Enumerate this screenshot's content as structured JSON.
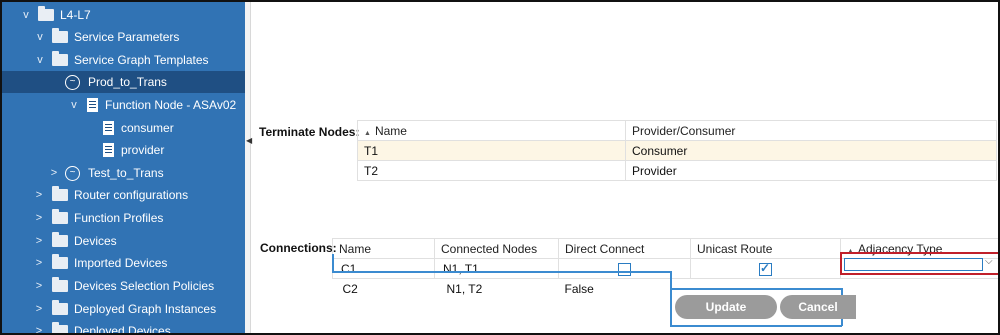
{
  "sidebar": {
    "items": [
      {
        "label": "L4-L7",
        "chevron": "v",
        "icon": "folder-icon"
      },
      {
        "label": "Service Parameters",
        "chevron": "v",
        "icon": "folder-icon"
      },
      {
        "label": "Service Graph Templates",
        "chevron": "v",
        "icon": "folder-icon"
      },
      {
        "label": "Prod_to_Trans",
        "chevron": "",
        "icon": "graph-icon"
      },
      {
        "label": "Function Node - ASAv02",
        "chevron": "v",
        "icon": "document-icon"
      },
      {
        "label": "consumer",
        "chevron": "",
        "icon": "document-icon"
      },
      {
        "label": "provider",
        "chevron": "",
        "icon": "document-icon"
      },
      {
        "label": "Test_to_Trans",
        "chevron": ">",
        "icon": "graph-icon"
      },
      {
        "label": "Router configurations",
        "chevron": ">",
        "icon": "folder-icon"
      },
      {
        "label": "Function Profiles",
        "chevron": ">",
        "icon": "folder-icon"
      },
      {
        "label": "Devices",
        "chevron": ">",
        "icon": "folder-icon"
      },
      {
        "label": "Imported Devices",
        "chevron": ">",
        "icon": "folder-icon"
      },
      {
        "label": "Devices Selection Policies",
        "chevron": ">",
        "icon": "folder-icon"
      },
      {
        "label": "Deployed Graph Instances",
        "chevron": ">",
        "icon": "folder-icon"
      },
      {
        "label": "Deployed Devices",
        "chevron": ">",
        "icon": "folder-icon"
      }
    ]
  },
  "terminate": {
    "label": "Terminate Nodes:",
    "headers": [
      "Name",
      "Provider/Consumer"
    ],
    "rows": [
      [
        "T1",
        "Consumer"
      ],
      [
        "T2",
        "Provider"
      ]
    ]
  },
  "connections": {
    "label": "Connections:",
    "headers": [
      "Name",
      "Connected Nodes",
      "Direct Connect",
      "Unicast Route",
      "Adjacency Type"
    ],
    "rows": [
      {
        "name": "C1",
        "nodes": "N1, T1",
        "direct": "",
        "direct_checked": false,
        "unicast_checked": true
      },
      {
        "name": "C2",
        "nodes": "N1, T2",
        "direct": "False"
      }
    ]
  },
  "buttons": {
    "update": "Update",
    "cancel": "Cancel"
  },
  "colors": {
    "sidebar": "#3173b4",
    "selected": "#1f4f83",
    "highlight": "#c0202a",
    "accent": "#3b8bd0"
  }
}
